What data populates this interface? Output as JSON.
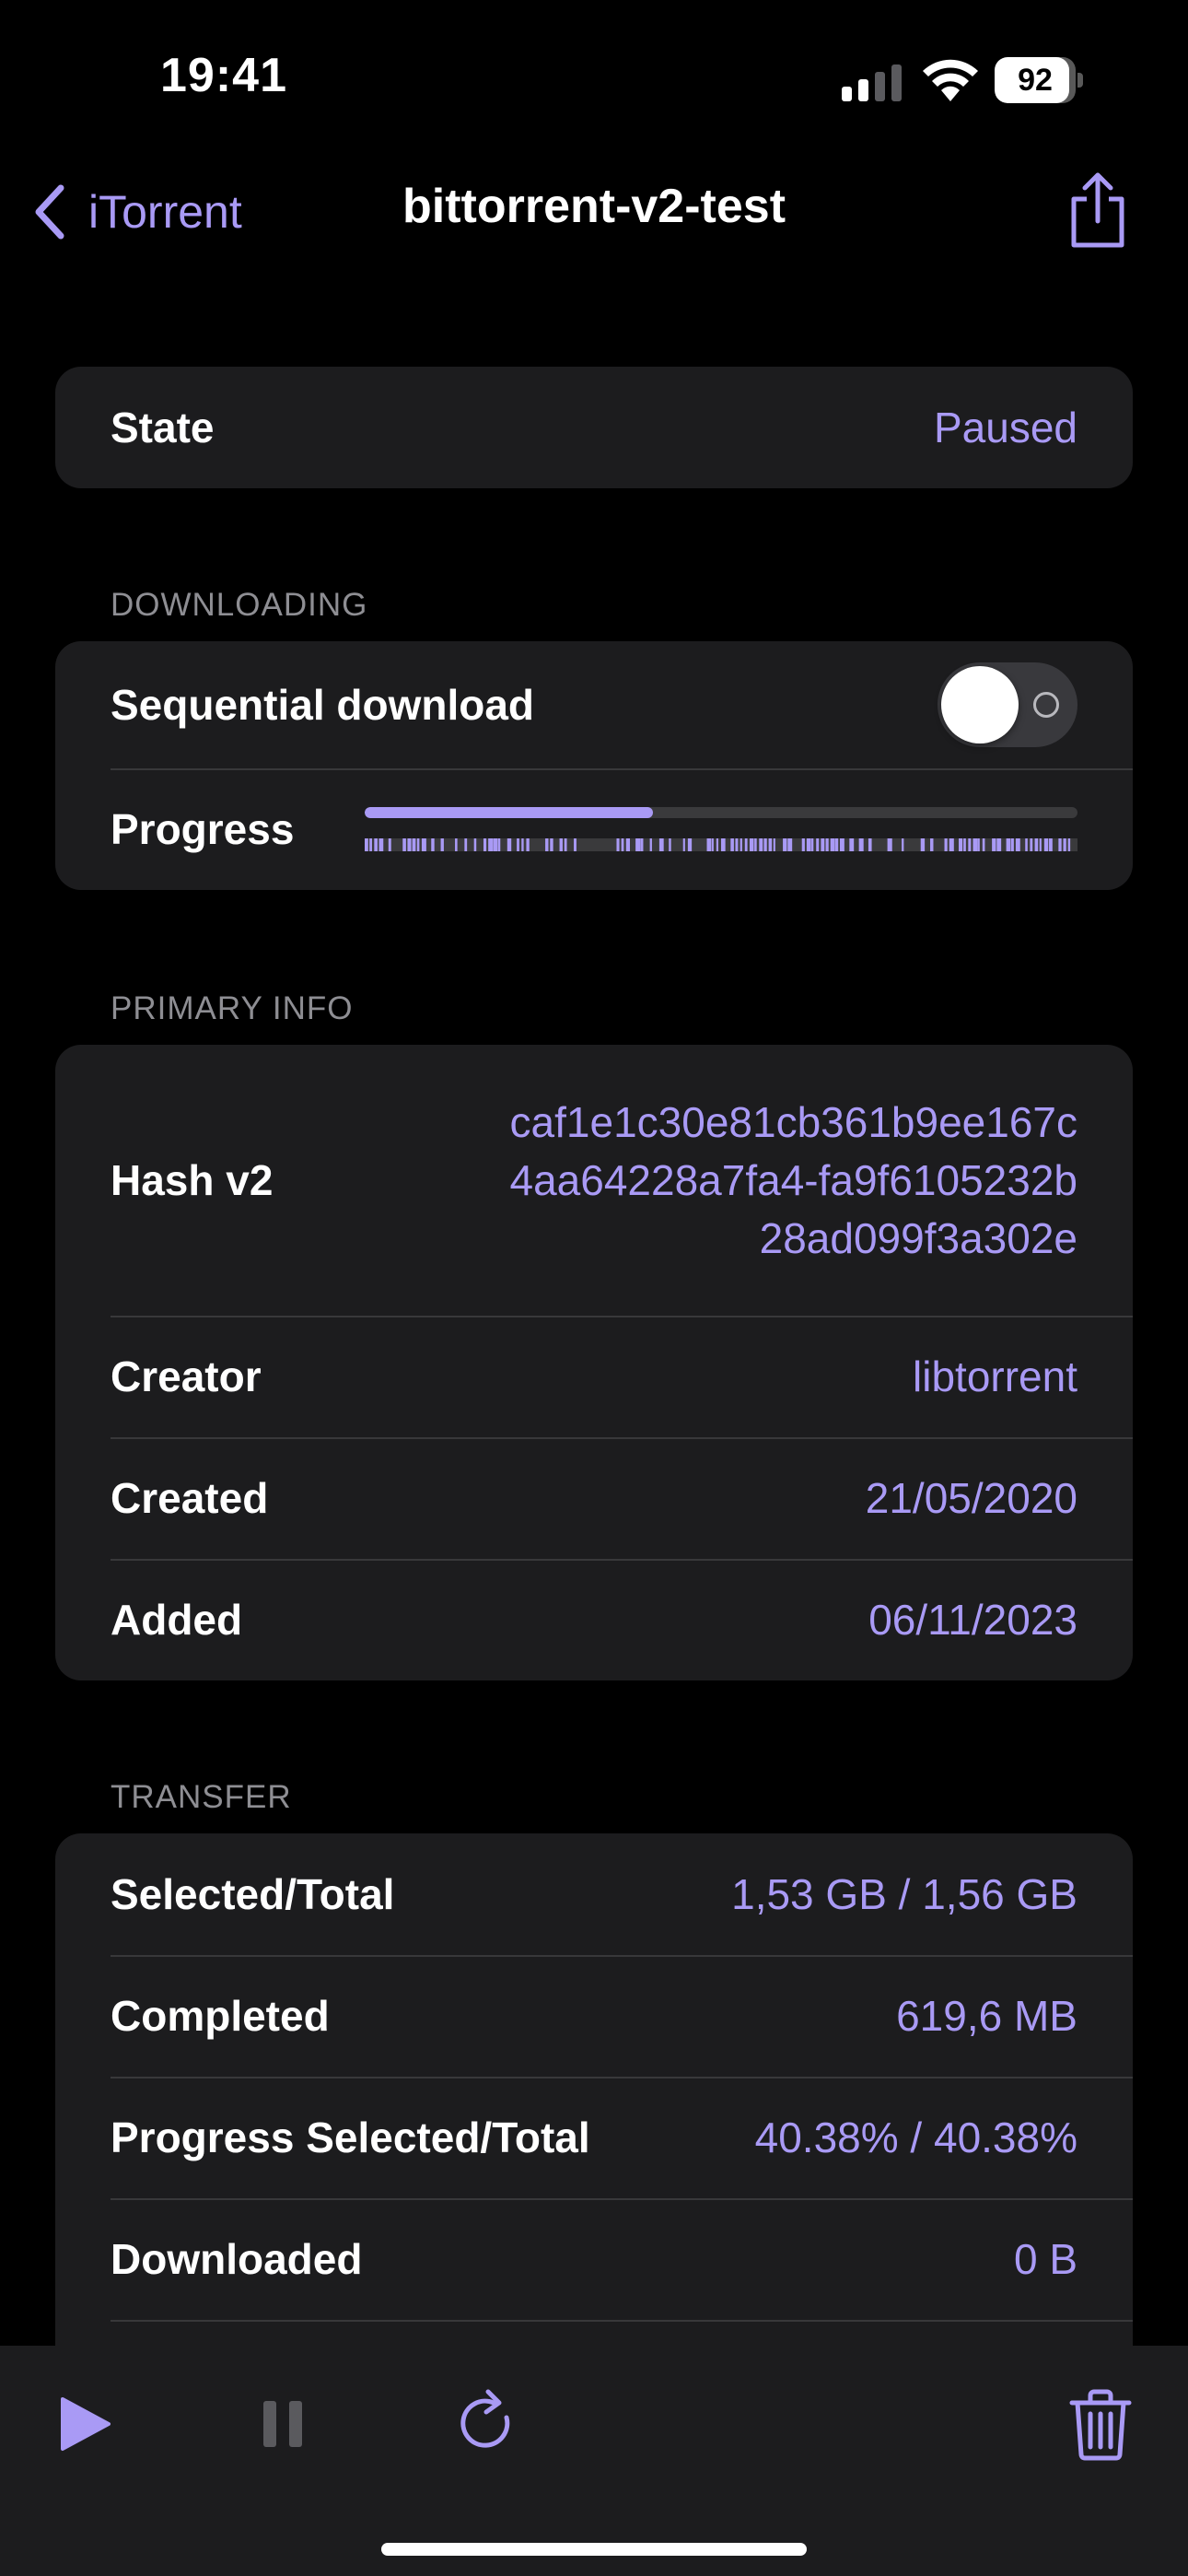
{
  "status_bar": {
    "time": "19:41",
    "battery_percent": "92",
    "battery_level": 0.92,
    "icons": [
      "cellular-signal-icon",
      "wifi-icon",
      "battery-icon"
    ]
  },
  "nav": {
    "back_label": "iTorrent",
    "title": "bittorrent-v2-test",
    "icons": [
      "chevron-left-icon",
      "share-icon"
    ]
  },
  "state_section": {
    "label": "State",
    "value": "Paused"
  },
  "downloading": {
    "header": "DOWNLOADING",
    "sequential_label": "Sequential download",
    "sequential_on": false,
    "progress_label": "Progress",
    "progress_fraction": 0.4038
  },
  "primary_info": {
    "header": "PRIMARY INFO",
    "rows": [
      {
        "label": "Hash v2",
        "value": "caf1e1c30e81cb361b9ee167c4aa64228a7fa4-fa9f6105232b28ad099f3a302e"
      },
      {
        "label": "Creator",
        "value": "libtorrent"
      },
      {
        "label": "Created",
        "value": "21/05/2020"
      },
      {
        "label": "Added",
        "value": "06/11/2023"
      }
    ]
  },
  "transfer": {
    "header": "TRANSFER",
    "rows": [
      {
        "label": "Selected/Total",
        "value": "1,53 GB / 1,56 GB"
      },
      {
        "label": "Completed",
        "value": "619,6 MB"
      },
      {
        "label": "Progress Selected/Total",
        "value": "40.38% / 40.38%"
      },
      {
        "label": "Downloaded",
        "value": "0 B"
      }
    ]
  },
  "toolbar": {
    "icons": [
      "play-icon",
      "pause-icon",
      "refresh-icon",
      "trash-icon"
    ]
  },
  "colors": {
    "accent": "#a99af5",
    "background": "#000000",
    "card": "#1c1c1e",
    "separator": "#38383a",
    "secondary_text": "#8e8e93"
  }
}
